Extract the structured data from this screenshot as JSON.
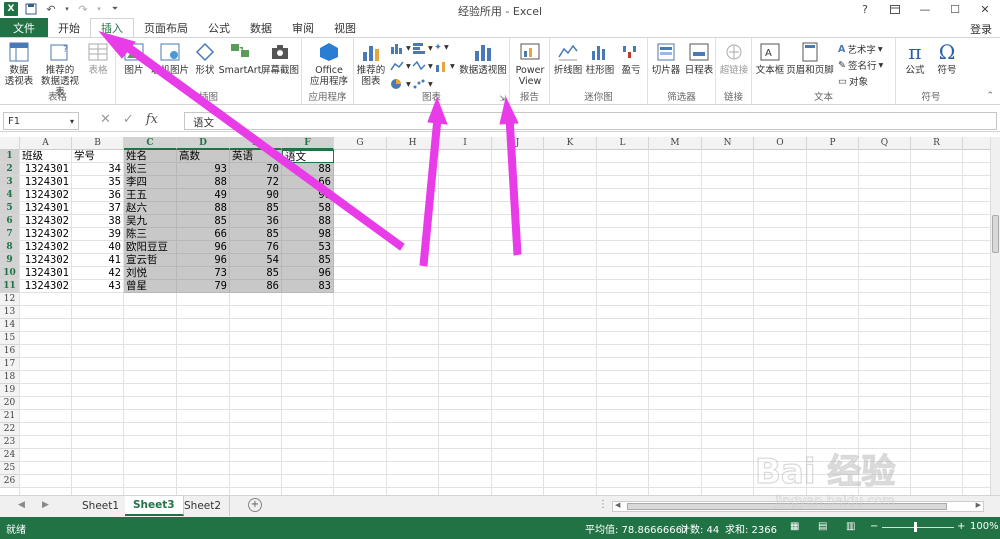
{
  "titlebar": {
    "title": "经验所用 - Excel",
    "app_icon": "X",
    "help": "?",
    "minimize": "—",
    "maximize": "☐",
    "close": "✕",
    "login": "登录"
  },
  "tabs": [
    "文件",
    "开始",
    "插入",
    "页面布局",
    "公式",
    "数据",
    "审阅",
    "视图"
  ],
  "ribbon": {
    "groups": [
      "表格",
      "插图",
      "应用程序",
      "图表",
      "报告",
      "迷你图",
      "筛选器",
      "链接",
      "文本",
      "符号"
    ],
    "buttons": {
      "pivot": "数据\n透视表",
      "rec_pivot": "推荐的\n数据透视表",
      "table": "表格",
      "pictures": "图片",
      "online_pictures": "联机图片",
      "shapes": "形状",
      "smartart": "SmartArt",
      "screenshot": "屏幕截图",
      "office_apps": "Office\n应用程序",
      "rec_charts": "推荐的\n图表",
      "pivot_chart": "数据透视图",
      "power_view": "Power\nView",
      "line": "折线图",
      "column": "柱形图",
      "winloss": "盈亏",
      "slicer": "切片器",
      "timeline": "日程表",
      "hyperlink": "超链接",
      "textbox": "文本框",
      "header_footer": "页眉和页脚",
      "wordart": "艺术字",
      "signature": "签名行",
      "object": "对象",
      "equation": "公式",
      "symbol": "符号"
    }
  },
  "formula": {
    "namebox": "F1",
    "value": "语文",
    "fx": "fx",
    "cancel": "✕",
    "enter": "✓"
  },
  "columns": [
    "A",
    "B",
    "C",
    "D",
    "E",
    "F",
    "G",
    "H",
    "I",
    "J",
    "K",
    "L",
    "M",
    "N",
    "O",
    "P",
    "Q",
    "R"
  ],
  "rows": [
    "1",
    "2",
    "3",
    "4",
    "5",
    "6",
    "7",
    "8",
    "9",
    "10",
    "11",
    "12",
    "13",
    "14",
    "15",
    "16",
    "17",
    "18",
    "19",
    "20",
    "21",
    "22",
    "23",
    "24",
    "25",
    "26"
  ],
  "sheet": {
    "header": [
      "班级",
      "学号",
      "姓名",
      "高数",
      "英语",
      "语文"
    ],
    "data": [
      [
        "1324301",
        "34",
        "张三",
        "93",
        "70",
        "88"
      ],
      [
        "1324301",
        "35",
        "李四",
        "88",
        "72",
        "66"
      ],
      [
        "1324302",
        "36",
        "王五",
        "49",
        "90",
        "99"
      ],
      [
        "1324301",
        "37",
        "赵六",
        "88",
        "85",
        "58"
      ],
      [
        "1324302",
        "38",
        "吴九",
        "85",
        "36",
        "88"
      ],
      [
        "1324302",
        "39",
        "陈三",
        "66",
        "85",
        "98"
      ],
      [
        "1324302",
        "40",
        "欧阳豆豆",
        "96",
        "76",
        "53"
      ],
      [
        "1324302",
        "41",
        "宣云哲",
        "96",
        "54",
        "85"
      ],
      [
        "1324301",
        "42",
        "刘悦",
        "73",
        "85",
        "96"
      ],
      [
        "1324302",
        "43",
        "曾星",
        "79",
        "86",
        "83"
      ]
    ]
  },
  "sheettabs": [
    "Sheet1",
    "Sheet3",
    "Sheet2"
  ],
  "addsheet": "+",
  "status": {
    "ready": "就绪",
    "average": "平均值: 78.86666667",
    "count": "计数: 44",
    "sum": "求和: 2366",
    "zoom": "100%",
    "minus": "−",
    "plus": "+"
  },
  "watermark": {
    "text": "Bai 经验",
    "url": "jingyan.baidu.com"
  },
  "colors": {
    "excel_green": "#217346",
    "arrow": "#e83ce8",
    "selection": "#c8c8c8"
  }
}
